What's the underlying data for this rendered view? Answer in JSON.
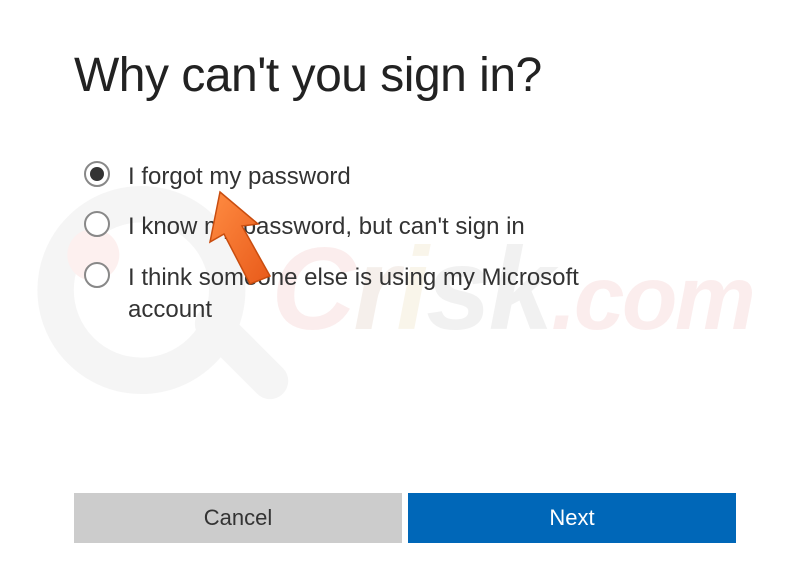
{
  "title": "Why can't you sign in?",
  "options": [
    {
      "label": "I forgot my password",
      "selected": true
    },
    {
      "label": "I know my password, but can't sign in",
      "selected": false
    },
    {
      "label": "I think someone else is using my Microsoft account",
      "selected": false
    }
  ],
  "buttons": {
    "cancel": "Cancel",
    "next": "Next"
  },
  "watermark": "PCrisk.com"
}
